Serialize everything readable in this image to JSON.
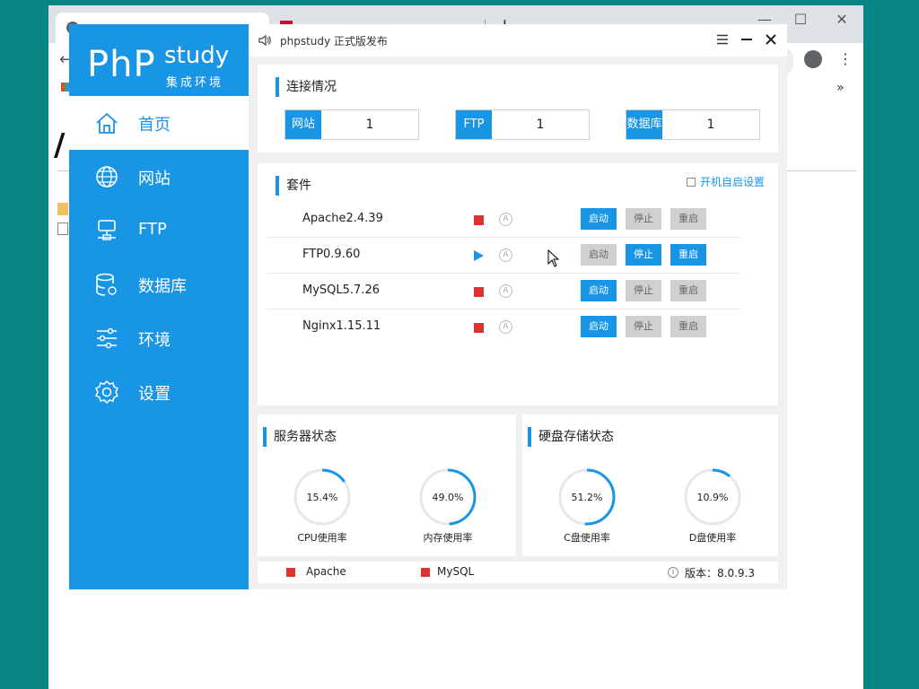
{
  "browser": {
    "tab2_title": "",
    "new_tab": "+",
    "bookmarks_more": "»",
    "heading": "/",
    "window_controls": {
      "minimize": "—",
      "maximize": "☐",
      "close": "✕"
    }
  },
  "app": {
    "title": "phpstudy 正式版发布",
    "logo": {
      "php": "PhP",
      "study": "study",
      "subtitle": "集成环境"
    },
    "sidebar": {
      "items": [
        {
          "label": "首页",
          "icon": "home-icon",
          "active": true
        },
        {
          "label": "网站",
          "icon": "globe-icon"
        },
        {
          "label": "FTP",
          "icon": "ftp-server-icon"
        },
        {
          "label": "数据库",
          "icon": "database-icon"
        },
        {
          "label": "环境",
          "icon": "sliders-icon"
        },
        {
          "label": "设置",
          "icon": "gear-icon"
        }
      ]
    },
    "connection": {
      "title": "连接情况",
      "boxes": [
        {
          "tag": "网站",
          "value": "1"
        },
        {
          "tag": "FTP",
          "value": "1"
        },
        {
          "tag": "数据库",
          "value": "1"
        }
      ]
    },
    "suite": {
      "title": "套件",
      "autostart_label": "开机自启设置",
      "auto_glyph": "A",
      "rows": [
        {
          "name": "Apache2.4.39",
          "status": "stopped",
          "start": "启动",
          "stop": "停止",
          "restart": "重启"
        },
        {
          "name": "FTP0.9.60",
          "status": "running",
          "start": "启动",
          "stop": "停止",
          "restart": "重启"
        },
        {
          "name": "MySQL5.7.26",
          "status": "stopped",
          "start": "启动",
          "stop": "停止",
          "restart": "重启"
        },
        {
          "name": "Nginx1.15.11",
          "status": "stopped",
          "start": "启动",
          "stop": "停止",
          "restart": "重启"
        }
      ]
    },
    "server_status": {
      "title": "服务器状态",
      "gauges": [
        {
          "value": "15.4%",
          "fraction": 0.154,
          "label": "CPU使用率"
        },
        {
          "value": "49.0%",
          "fraction": 0.49,
          "label": "内存使用率"
        }
      ]
    },
    "disk_status": {
      "title": "硬盘存储状态",
      "gauges": [
        {
          "value": "51.2%",
          "fraction": 0.512,
          "label": "C盘使用率"
        },
        {
          "value": "10.9%",
          "fraction": 0.109,
          "label": "D盘使用率"
        }
      ]
    },
    "footer": {
      "legend": [
        "Apache",
        "MySQL"
      ],
      "info_glyph": "i",
      "version": "版本：8.0.9.3"
    },
    "colors": {
      "accent": "#1995e6",
      "stopped": "#e03030",
      "button_off": "#d0d0d0"
    }
  }
}
